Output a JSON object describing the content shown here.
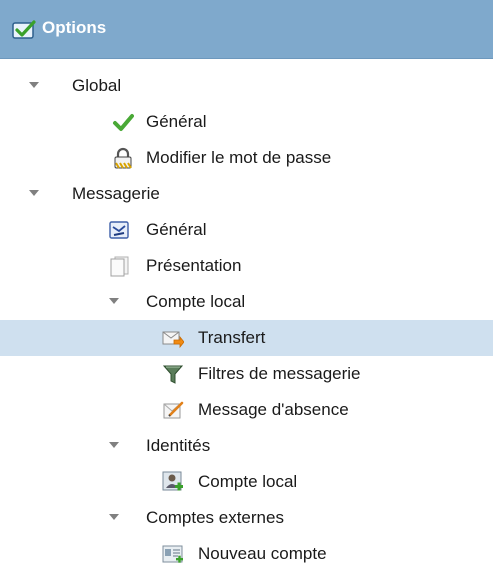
{
  "header": {
    "title": "Options",
    "icon": "options-check-icon"
  },
  "tree": {
    "global": {
      "label": "Global",
      "items": [
        {
          "label": "Général",
          "icon": "checkmark-icon"
        },
        {
          "label": "Modifier le mot de passe",
          "icon": "padlock-icon"
        }
      ]
    },
    "messagerie": {
      "label": "Messagerie",
      "items": [
        {
          "label": "Général",
          "icon": "mail-settings-icon"
        },
        {
          "label": "Présentation",
          "icon": "document-icon"
        }
      ],
      "compte_local": {
        "label": "Compte local",
        "items": [
          {
            "label": "Transfert",
            "icon": "mail-forward-icon",
            "selected": true
          },
          {
            "label": "Filtres de messagerie",
            "icon": "filter-icon"
          },
          {
            "label": "Message d'absence",
            "icon": "absence-message-icon"
          }
        ]
      },
      "identites": {
        "label": "Identités",
        "items": [
          {
            "label": "Compte local",
            "icon": "add-identity-icon"
          }
        ]
      },
      "comptes_externes": {
        "label": "Comptes externes",
        "items": [
          {
            "label": "Nouveau compte",
            "icon": "new-account-icon"
          }
        ]
      }
    }
  },
  "colors": {
    "header_bg": "#7fa9cc",
    "selected_bg": "#cfe0ef"
  }
}
